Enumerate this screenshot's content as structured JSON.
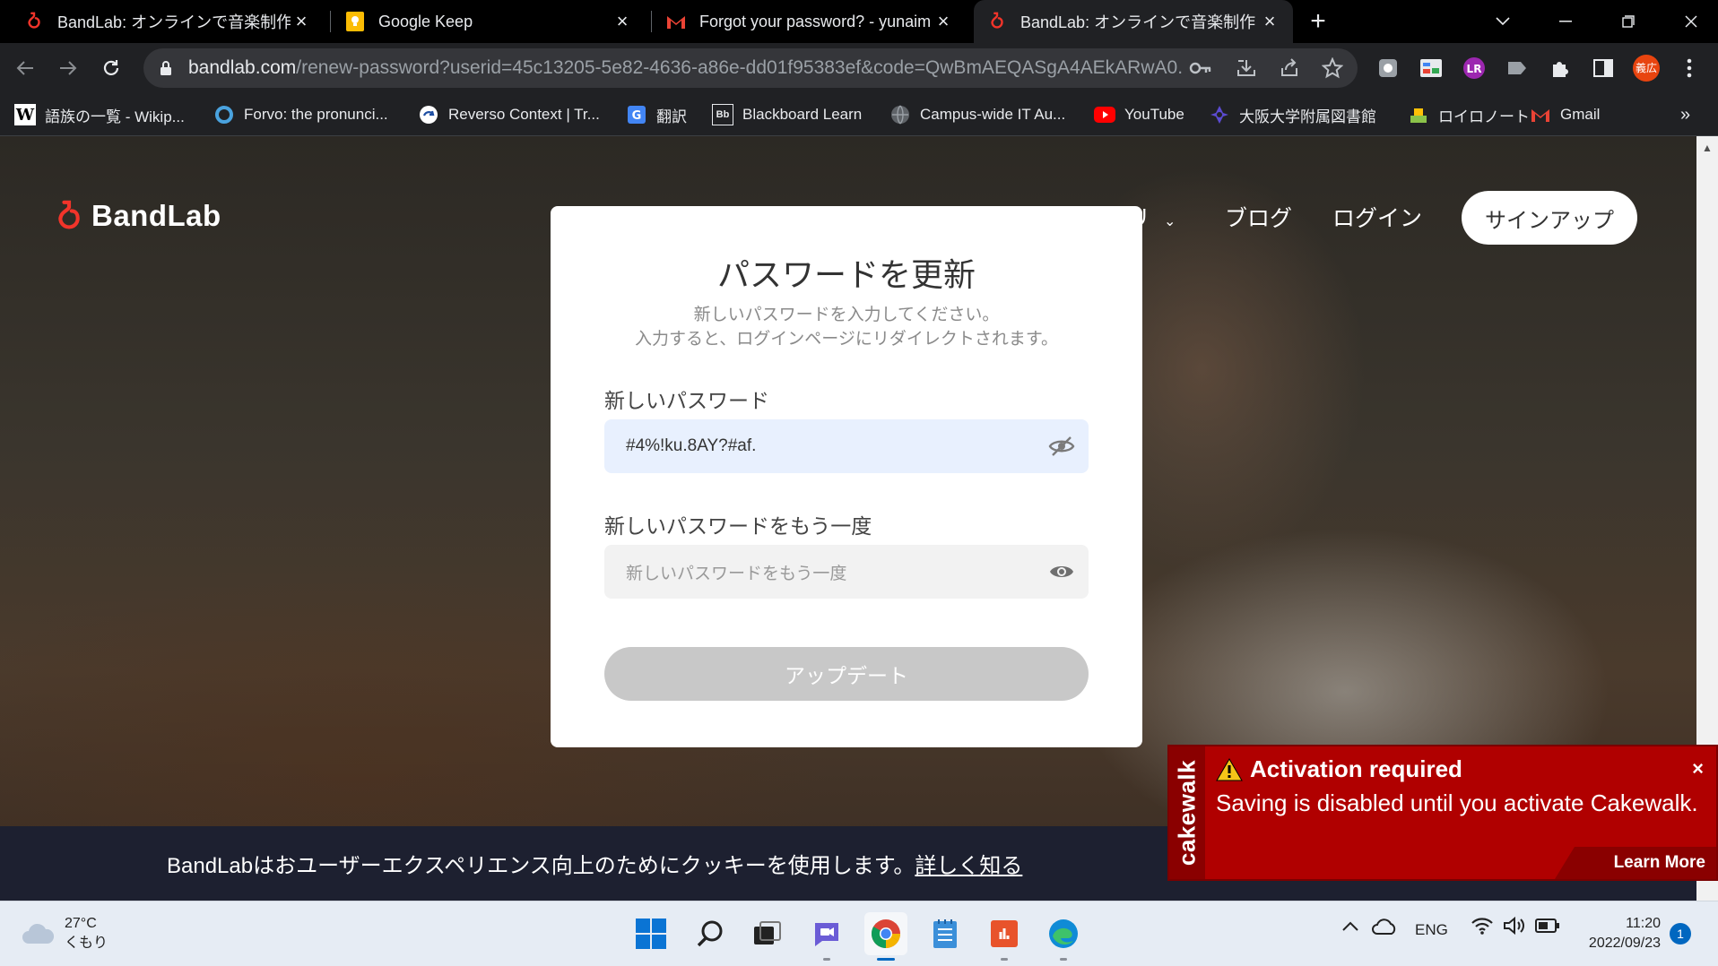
{
  "browser": {
    "tabs": [
      {
        "title": "BandLab: オンラインで音楽制作",
        "active": false,
        "favicon": "bandlab-icon"
      },
      {
        "title": "Google Keep",
        "active": false,
        "favicon": "keep-icon"
      },
      {
        "title": "Forgot your password? - yunaim",
        "active": false,
        "favicon": "gmail-icon"
      },
      {
        "title": "BandLab: オンラインで音楽制作",
        "active": true,
        "favicon": "bandlab-icon"
      }
    ],
    "url": {
      "host": "bandlab.com",
      "path": "/renew-password?userid=45c13205-5e82-4636-a86e-dd01f95383ef&code=QwBmAEQASgA4AEkARwA0..."
    },
    "profile_label": "義広",
    "bookmarks": [
      {
        "label": "語族の一覧 - Wikip...",
        "icon": "wikipedia-icon"
      },
      {
        "label": "Forvo: the pronunci...",
        "icon": "forvo-icon"
      },
      {
        "label": "Reverso Context | Tr...",
        "icon": "reverso-icon"
      },
      {
        "label": "翻訳",
        "icon": "translate-icon"
      },
      {
        "label": "Blackboard Learn",
        "icon": "blackboard-icon"
      },
      {
        "label": "Campus-wide IT Au...",
        "icon": "campus-icon"
      },
      {
        "label": "YouTube",
        "icon": "youtube-icon"
      },
      {
        "label": "大阪大学附属図書館",
        "icon": "library-icon"
      },
      {
        "label": "ロイロノート",
        "icon": "loilo-icon"
      },
      {
        "label": "Gmail",
        "icon": "gmail-icon"
      }
    ],
    "bookmarks_more": "»"
  },
  "site": {
    "logo_text": "BandLab",
    "nav": {
      "partial_item": "リ",
      "blog": "ブログ",
      "login": "ログイン",
      "signup": "サインアップ"
    }
  },
  "modal": {
    "title": "パスワードを更新",
    "subtitle_line1": "新しいパスワードを入力してください。",
    "subtitle_line2": "入力すると、ログインページにリダイレクトされます。",
    "new_password_label": "新しいパスワード",
    "new_password_value": "#4%!ku.8AY?#af.",
    "confirm_label": "新しいパスワードをもう一度",
    "confirm_placeholder": "新しいパスワードをもう一度",
    "update_button": "アップデート"
  },
  "cookie": {
    "text": "BandLabはおユーザーエクスペリエンス向上のためにクッキーを使用します。",
    "link": "詳しく知る"
  },
  "cakewalk": {
    "brand": "cakewalk",
    "title": "Activation required",
    "message": "Saving is disabled until you activate Cakewalk.",
    "learn_more": "Learn More",
    "close": "×"
  },
  "taskbar": {
    "weather_temp": "27°C",
    "weather_desc": "くもり",
    "language": "ENG",
    "time": "11:20",
    "date": "2022/09/23",
    "notification_count": "1"
  },
  "colors": {
    "bandlab_red": "#f2342a",
    "cakewalk_red": "#b00000",
    "chrome_dark": "#202124"
  }
}
